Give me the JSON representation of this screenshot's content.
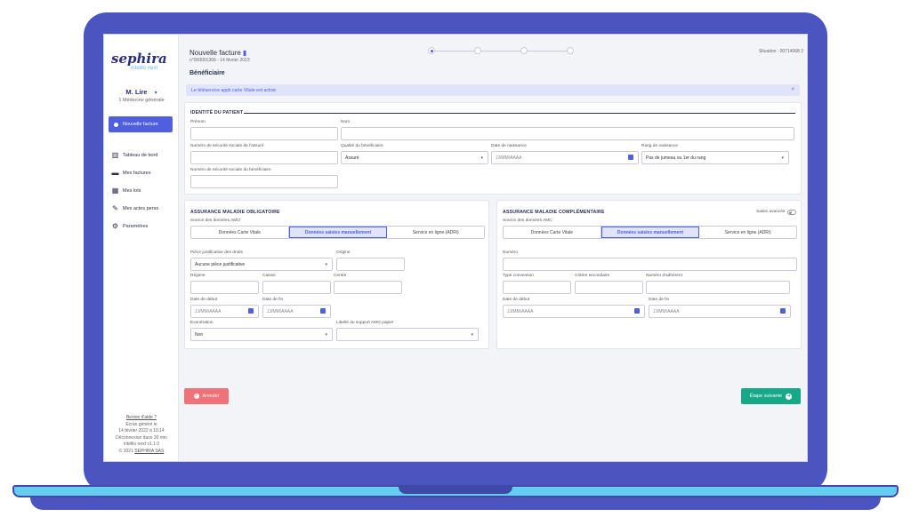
{
  "sidebar": {
    "logo_main": "sephira",
    "logo_sub": "intellio next",
    "user_name": "M. Lire",
    "user_role": "1 Médecine générale",
    "new_invoice": "Nouvelle facture",
    "items": [
      {
        "label": "Tableau de bord",
        "icon": "chart-icon"
      },
      {
        "label": "Mes factures",
        "icon": "folder-icon"
      },
      {
        "label": "Mes lots",
        "icon": "grid-icon"
      },
      {
        "label": "Mes actes perso",
        "icon": "pen-icon"
      },
      {
        "label": "Paramètres",
        "icon": "gear-icon"
      }
    ],
    "footer": {
      "help": "Besoin d'aide ?",
      "screen_generated": "Ecran généré le",
      "date": "14 février 2022 à 10:14",
      "logout": "Déconnexion dans 30 min",
      "version": "intellio next v1.1.0",
      "copyright": "© 2021 ",
      "company": "SEPHIRA SAS"
    }
  },
  "header": {
    "title": "Nouvelle facture",
    "subtitle": "n°000001366 - 14 février 2023",
    "situation": "Situation : 00714068 2",
    "section": "Bénéficiaire",
    "alert": "Le téléservice appli carte Vitale est activé."
  },
  "patient": {
    "title": "IDENTITÉ DU PATIENT",
    "prenom_label": "Prénom",
    "nom_label": "Nom",
    "nss_assure_label": "Numéro de sécurité sociale de l'assuré",
    "qualite_label": "Qualité du bénéficiaire",
    "qualite_value": "Assuré",
    "date_naissance_label": "Date de naissance",
    "date_placeholder": "JJ/MM/AAAA",
    "rang_label": "Rang de naissance",
    "rang_value": "Pas de jumeau ou 1er du rang",
    "nss_benef_label": "Numéro de sécurité sociale du bénéficiaire"
  },
  "amo": {
    "title": "ASSURANCE MALADIE OBLIGATOIRE",
    "source_label": "Source des données AMO",
    "options": [
      "Données Carte Vitale",
      "Données saisies manuellement",
      "Service en ligne (ADRi)"
    ],
    "piece_label": "Pièce justificative des droits",
    "piece_value": "Aucune pièce justificative",
    "origine_label": "Origine",
    "regime_label": "Régime",
    "caisse_label": "Caisse",
    "centre_label": "Centre",
    "date_debut_label": "Date de début",
    "date_fin_label": "Date de fin",
    "exoneration_label": "Exonération",
    "exoneration_value": "Non",
    "libelle_label": "Libellé du support AMO papier"
  },
  "amc": {
    "title": "ASSURANCE MALADIE COMPLÉMENTAIRE",
    "advanced_label": "Saisie avancée",
    "source_label": "Source des données AMC",
    "options": [
      "Données Carte Vitale",
      "Données saisies manuellement",
      "Service en ligne (ADRi)"
    ],
    "numero_label": "Numéro",
    "type_convention_label": "Type convention",
    "critere_label": "Critère secondaire",
    "adherent_label": "Numéro d'adhérent",
    "date_debut_label": "Date de début",
    "date_fin_label": "Date de fin"
  },
  "actions": {
    "cancel": "Annuler",
    "next": "Étape suivante"
  },
  "colors": {
    "frame": "#4a55c0",
    "accent": "#4f5fe0",
    "cancel": "#f07178",
    "next": "#17a88a"
  }
}
